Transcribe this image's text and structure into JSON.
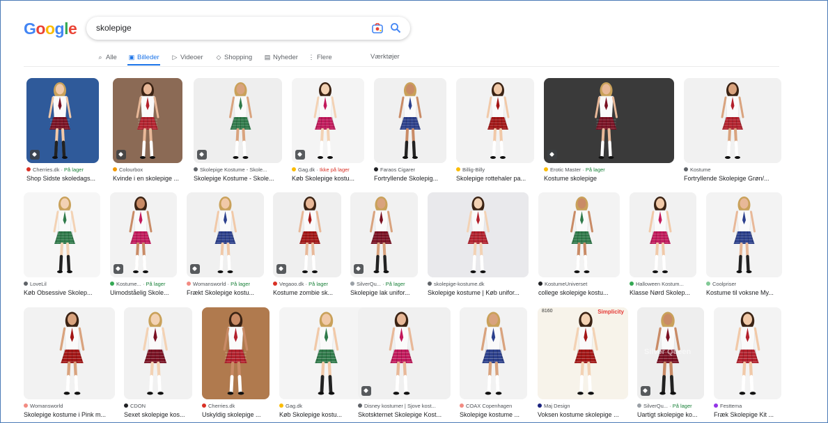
{
  "logo": {
    "letters": [
      {
        "ch": "G",
        "color": "#4285f4"
      },
      {
        "ch": "o",
        "color": "#ea4335"
      },
      {
        "ch": "o",
        "color": "#fbbc05"
      },
      {
        "ch": "g",
        "color": "#4285f4"
      },
      {
        "ch": "l",
        "color": "#34a853"
      },
      {
        "ch": "e",
        "color": "#ea4335"
      }
    ]
  },
  "search": {
    "value": "skolepige",
    "camera_icon": "camera-lens-icon",
    "search_icon": "search-icon"
  },
  "tabs": [
    {
      "label": "Alle",
      "icon": "⌕",
      "active": false
    },
    {
      "label": "Billeder",
      "icon": "▣",
      "active": true
    },
    {
      "label": "Videoer",
      "icon": "▷",
      "active": false
    },
    {
      "label": "Shopping",
      "icon": "◇",
      "active": false
    },
    {
      "label": "Nyheder",
      "icon": "▤",
      "active": false
    },
    {
      "label": "Flere",
      "icon": "⋮",
      "active": false
    },
    {
      "label": "Værktøjer",
      "icon": "",
      "active": false
    }
  ],
  "rows": [
    [
      {
        "source": "Cherries.dk",
        "stock": "På lager",
        "title": "Shop Sidste skoledags...",
        "fav": "#d93025",
        "badge": true,
        "bg": "#2f5a9a"
      },
      {
        "source": "Colourbox",
        "stock": "",
        "title": "Kvinde i en skolepige ...",
        "fav": "#f29900",
        "badge": true,
        "bg": "#8b6a55"
      },
      {
        "source": "Skolepige Kostume - Skole...",
        "stock": "",
        "title": "Skolepige Kostume - Skole...",
        "fav": "#5f6368",
        "badge": true,
        "bg": "#eeeeee"
      },
      {
        "source": "Gag.dk",
        "stock": "Ikke på lager",
        "stock_red": true,
        "title": "Køb Skolepige kostu...",
        "fav": "#fbbc05",
        "badge": true,
        "bg": "#f4f4f4"
      },
      {
        "source": "Faraos Cigarer",
        "stock": "",
        "title": "Fortryllende Skolepig...",
        "fav": "#202124",
        "badge": false,
        "bg": "#f0f0f0"
      },
      {
        "source": "Billig-Billy",
        "stock": "",
        "title": "Skolepige rottehaler pa...",
        "fav": "#fbbc05",
        "badge": false,
        "bg": "#f2f2f2"
      },
      {
        "source": "Erotic Master",
        "stock": "På lager",
        "title": "Kostume skolepige",
        "fav": "#fbbc05",
        "badge": true,
        "bg": "#3a3a3a"
      },
      {
        "source": "Kostume",
        "stock": "",
        "title": "Fortryllende Skolepige Grøn/...",
        "fav": "#5f6368",
        "badge": false,
        "bg": "#f1f1f1"
      }
    ],
    [
      {
        "source": "LoveLil",
        "stock": "",
        "title": "Køb Obsessive Skolep...",
        "fav": "#5f6368",
        "badge": false,
        "bg": "#f6f6f6"
      },
      {
        "source": "Kostume...",
        "stock": "På lager",
        "title": "Uimodståelig Skole...",
        "fav": "#34a853",
        "badge": true,
        "bg": "#f2f2f2"
      },
      {
        "source": "Womansworld",
        "stock": "På lager",
        "title": "Frækt Skolepige kostu...",
        "fav": "#f28b82",
        "badge": true,
        "bg": "#f0f0f0"
      },
      {
        "source": "Vegaoo.dk",
        "stock": "På lager",
        "title": "Kostume zombie sk...",
        "fav": "#d93025",
        "badge": true,
        "bg": "#efefef"
      },
      {
        "source": "SilverQu...",
        "stock": "På lager",
        "title": "Skolepige lak unifor...",
        "fav": "#9aa0a6",
        "badge": true,
        "bg": "#f1f1f1"
      },
      {
        "source": "skolepige-kostume.dk",
        "stock": "",
        "title": "Skolepige kostume | Køb unifor...",
        "fav": "#5f6368",
        "badge": false,
        "bg": "#e9e9ec"
      },
      {
        "source": "KostumeUniverset",
        "stock": "",
        "title": "college skolepige kostu...",
        "fav": "#202124",
        "badge": false,
        "bg": "#f3f3f3"
      },
      {
        "source": "Halloween Kostum...",
        "stock": "",
        "title": "Klasse Nørd Skolep...",
        "fav": "#34a853",
        "badge": false,
        "bg": "#f1f1f1"
      },
      {
        "source": "Coolpriser",
        "stock": "",
        "title": "Kostume til voksne My...",
        "fav": "#81c995",
        "badge": false,
        "bg": "#f3f3f3"
      }
    ],
    [
      {
        "source": "Womansworld",
        "stock": "",
        "title": "Skolepige kostume i Pink m...",
        "fav": "#f28b82",
        "badge": false,
        "bg": "#f2f2f2"
      },
      {
        "source": "CDON",
        "stock": "",
        "title": "Sexet skolepige kos...",
        "fav": "#202124",
        "badge": false,
        "bg": "#f1f1f1"
      },
      {
        "source": "Cherries.dk",
        "stock": "",
        "title": "Uskyldig skolepige ...",
        "fav": "#d93025",
        "badge": false,
        "bg": "#b07a4e"
      },
      {
        "source": "Gag.dk",
        "stock": "",
        "title": "Køb Skolepige kostu...",
        "fav": "#fbbc05",
        "badge": false,
        "bg": "#f4f4f4"
      },
      {
        "source": "Disney kostumer | Sjove kost...",
        "stock": "",
        "title": "Skotskternet Skolepige Kost...",
        "fav": "#5f6368",
        "badge": true,
        "bg": "#f0f0f0"
      },
      {
        "source": "COAX Copenhagen",
        "stock": "",
        "title": "Skolepige kostume ...",
        "fav": "#f28b82",
        "badge": false,
        "bg": "#f2f2f2"
      },
      {
        "source": "Maj Design",
        "stock": "",
        "title": "Voksen kostume skolepige ...",
        "fav": "#1a237e",
        "badge": false,
        "bg": "#f7f3ea"
      },
      {
        "source": "SilverQu...",
        "stock": "På lager",
        "title": "Uartigt skolepige ko...",
        "fav": "#9aa0a6",
        "badge": true,
        "bg": "#eeeeee"
      },
      {
        "source": "Festtema",
        "stock": "",
        "title": "Fræk Skolepige Kit ...",
        "fav": "#9334e6",
        "badge": false,
        "bg": "#f3f3f3"
      }
    ]
  ],
  "pattern_text": {
    "label": "Simplicity",
    "code": "8160",
    "watermark": "Silver Queen"
  }
}
